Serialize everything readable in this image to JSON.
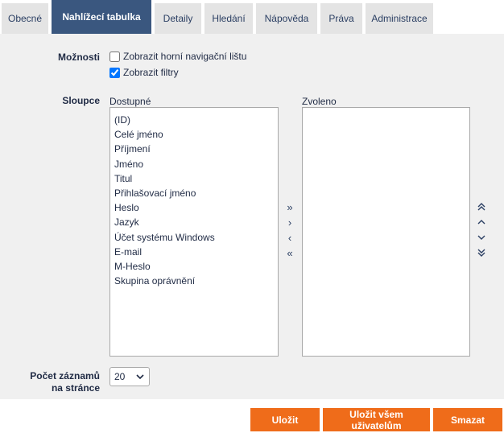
{
  "tabs": [
    {
      "label": "Obecné",
      "active": false
    },
    {
      "label": "Nahlížecí tabulka",
      "active": true
    },
    {
      "label": "Detaily",
      "active": false
    },
    {
      "label": "Hledání",
      "active": false
    },
    {
      "label": "Nápověda",
      "active": false
    },
    {
      "label": "Práva",
      "active": false
    },
    {
      "label": "Administrace",
      "active": false
    }
  ],
  "options": {
    "label": "Možnosti",
    "checkboxes": [
      {
        "label": "Zobrazit horní navigační lištu",
        "checked": false
      },
      {
        "label": "Zobrazit filtry",
        "checked": true
      }
    ]
  },
  "columns": {
    "label": "Sloupce",
    "available_title": "Dostupné",
    "selected_title": "Zvoleno",
    "available": [
      "(ID)",
      "Celé jméno",
      "Příjmení",
      "Jméno",
      "Titul",
      "Přihlašovací jméno",
      "Heslo",
      "Jazyk",
      "Účet systému Windows",
      "E-mail",
      "M-Heslo",
      "Skupina oprávnění"
    ],
    "selected": [],
    "move_icons": {
      "all_right": "»",
      "right": "›",
      "left": "‹",
      "all_left": "«"
    },
    "order_icons": [
      "double-chevron-up-icon",
      "chevron-up-icon",
      "chevron-down-icon",
      "double-chevron-down-icon"
    ]
  },
  "records": {
    "label_line1": "Počet záznamů",
    "label_line2": "na stránce",
    "value": "20"
  },
  "buttons": {
    "save": "Uložit",
    "save_all": "Uložit všem uživatelům",
    "delete": "Smazat"
  },
  "colors": {
    "accent": "#ef6c1a",
    "tab_active": "#3a577f",
    "tab_inactive": "#e4e4e4",
    "panel_bg": "#f0f0f0"
  }
}
